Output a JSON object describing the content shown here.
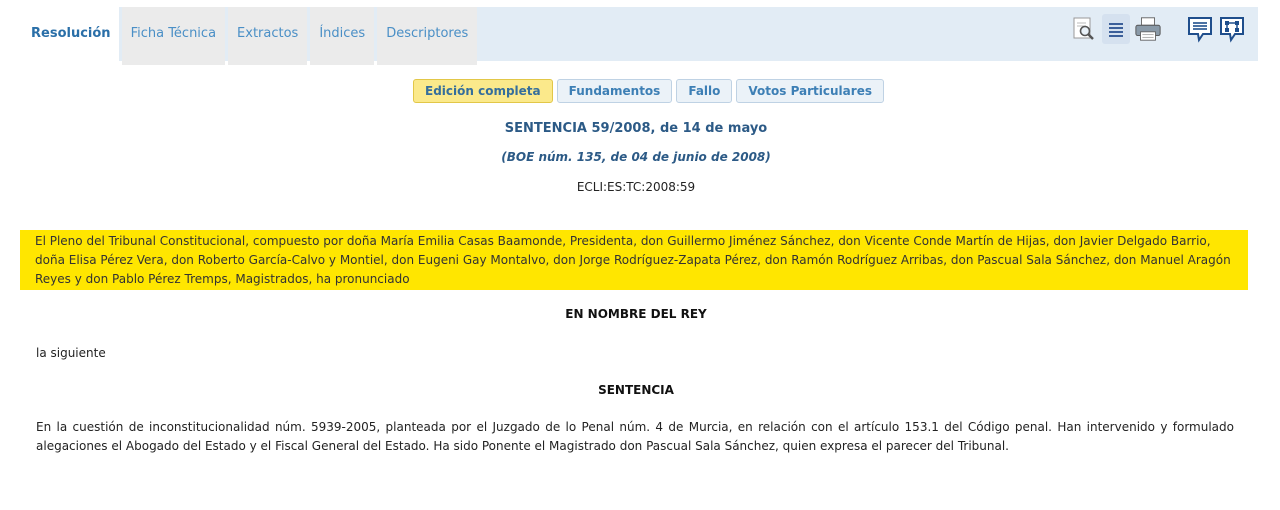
{
  "tabs": [
    {
      "label": "Resolución",
      "active": true
    },
    {
      "label": "Ficha Técnica",
      "active": false
    },
    {
      "label": "Extractos",
      "active": false
    },
    {
      "label": "Índices",
      "active": false
    },
    {
      "label": "Descriptores",
      "active": false
    }
  ],
  "toolbar": {
    "icons": [
      "search-document-icon",
      "list-view-icon",
      "print-icon",
      "comment-icon",
      "diagram-icon"
    ]
  },
  "subtabs": [
    {
      "label": "Edición completa",
      "active": true
    },
    {
      "label": "Fundamentos",
      "active": false
    },
    {
      "label": "Fallo",
      "active": false
    },
    {
      "label": "Votos Particulares",
      "active": false
    }
  ],
  "document": {
    "title": "SENTENCIA 59/2008, de 14 de mayo",
    "boe": "(BOE núm. 135, de 04 de junio de 2008)",
    "ecli": "ECLI:ES:TC:2008:59",
    "composition": "El Pleno del Tribunal Constitucional, compuesto por doña María Emilia Casas Baamonde, Presidenta, don Guillermo Jiménez Sánchez, don Vicente Conde Martín de Hijas, don Javier Delgado Barrio, doña Elisa Pérez Vera, don Roberto García-Calvo y Montiel, don Eugeni Gay Montalvo, don Jorge Rodríguez-Zapata Pérez, don Ramón Rodríguez Arribas, don Pascual Sala Sánchez, don Manuel Aragón Reyes y don Pablo Pérez Tremps, Magistrados, ha pronunciado",
    "heading_rey": "EN NOMBRE DEL REY",
    "siguiente": "la siguiente",
    "heading_sentencia": "SENTENCIA",
    "intro": "En la cuestión de inconstitucionalidad núm. 5939-2005, planteada por el Juzgado de lo Penal núm. 4 de Murcia, en relación con el artículo 153.1 del Código penal. Han intervenido y formulado alegaciones el Abogado del Estado y el Fiscal General del Estado. Ha sido Ponente el Magistrado don Pascual Sala Sánchez, quien expresa el parecer del Tribunal."
  },
  "colors": {
    "highlight": "#ffe600",
    "active_subtab": "#fbe98b",
    "topbar": "#e2ecf5",
    "link_blue": "#4a8fc6"
  }
}
